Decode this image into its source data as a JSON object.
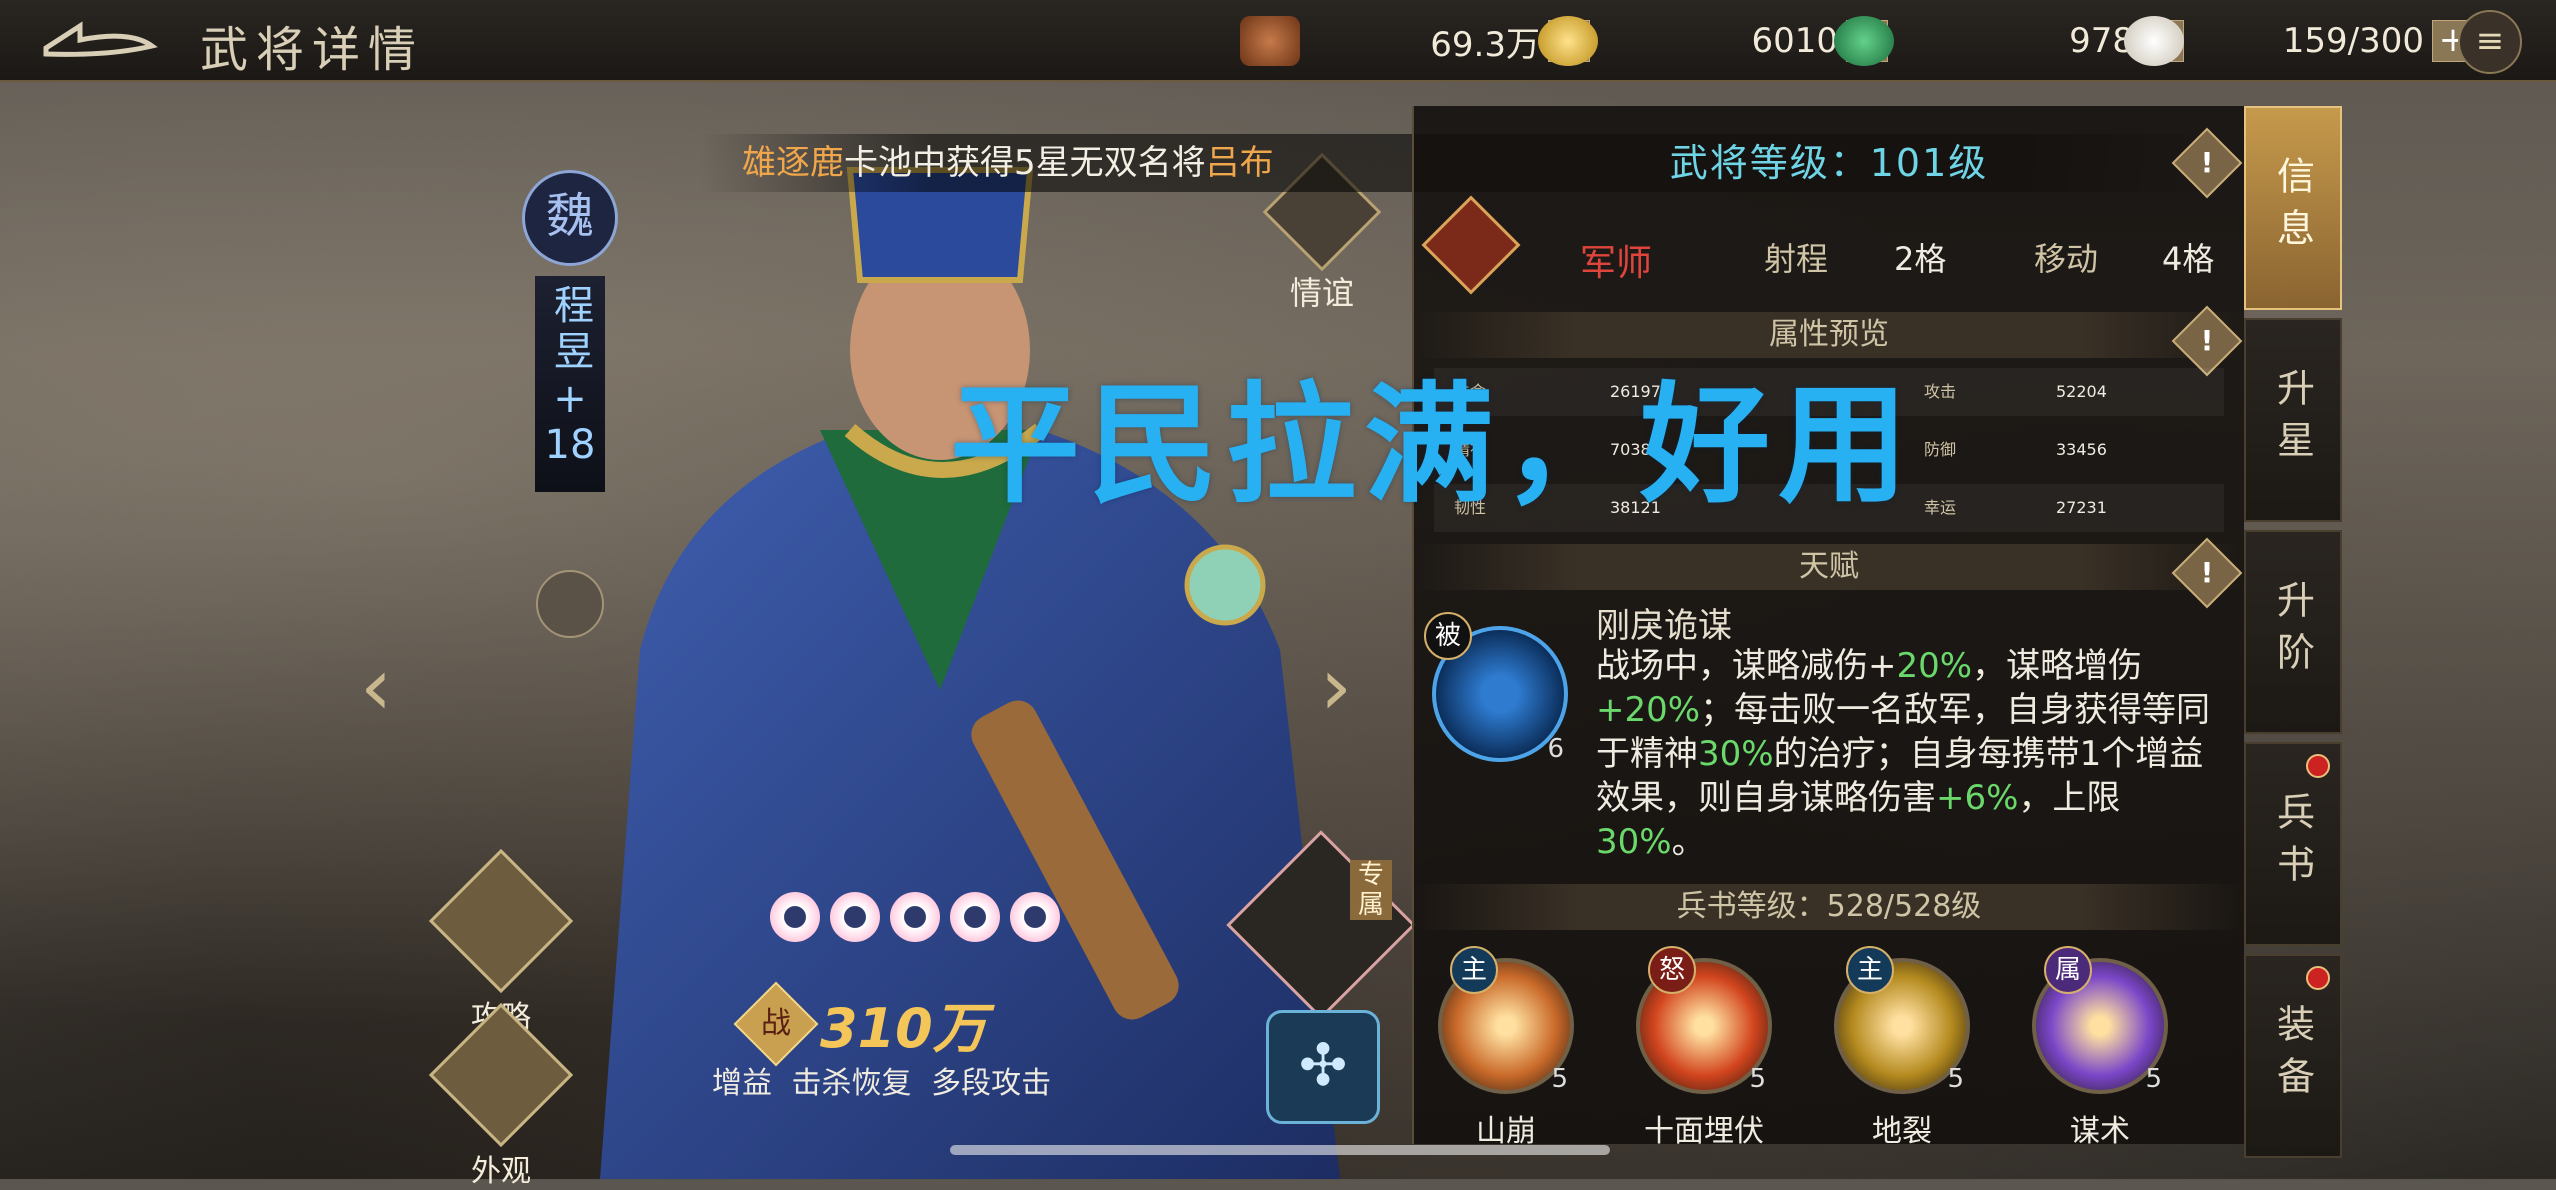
{
  "header": {
    "title": "武将详情",
    "resources": [
      {
        "icon": "copper-coins-icon",
        "value": "69.3万"
      },
      {
        "icon": "gold-coin-icon",
        "value": "6010"
      },
      {
        "icon": "jade-coin-icon",
        "value": "978"
      },
      {
        "icon": "steamed-bun-icon",
        "value": "159/300"
      }
    ],
    "plus_label": "+"
  },
  "announcement": {
    "player": "雄逐鹿",
    "middle": "卡池中获得5星无双名将",
    "hero": "吕布"
  },
  "hero": {
    "faction": "魏",
    "name": "程昱",
    "plus": "+",
    "rank": "18",
    "stars": 5,
    "power_badge": "战",
    "power": "310万",
    "traits": "增益 击杀恢复 多段攻击",
    "exclusive_tag": "专属"
  },
  "left_actions": {
    "strategy": "攻略",
    "appearance": "外观"
  },
  "bond": {
    "label": "情谊"
  },
  "overlay_caption": "平民拉满，好用",
  "panel": {
    "level_label": "武将等级：101级",
    "role": "军师",
    "range_label": "射程",
    "range_value": "2格",
    "move_label": "移动",
    "move_value": "4格",
    "attr_title": "属性预览",
    "attrs": [
      {
        "k": "生命",
        "v": "261973"
      },
      {
        "k": "攻击",
        "v": "52204"
      },
      {
        "k": "精神",
        "v": "70380"
      },
      {
        "k": "防御",
        "v": "33456"
      },
      {
        "k": "韧性",
        "v": "38121"
      },
      {
        "k": "幸运",
        "v": "27231"
      }
    ],
    "talent_title": "天赋",
    "talent": {
      "tag": "被",
      "level": "6",
      "name": "刚戾诡谋",
      "d1": "战场中，谋略减伤+",
      "g1": "20%",
      "d2": "，谋略增伤",
      "g2": "+20%",
      "d3": "；每击败一名敌军，自身获得等同于精神",
      "g3": "30%",
      "d4": "的治疗；自身每携带1个增益效果，则自身谋略伤害",
      "g4": "+6%",
      "d5": "，上限",
      "g5": "30%",
      "d6": "。"
    },
    "book_level": "兵书等级：528/528级",
    "skills": [
      {
        "tag": "主",
        "name": "山崩",
        "level": "5",
        "color": "#c96a2a"
      },
      {
        "tag": "怒",
        "name": "十面埋伏",
        "level": "5",
        "color": "#d2451e"
      },
      {
        "tag": "主",
        "name": "地裂",
        "level": "5",
        "color": "#b48a1f"
      },
      {
        "tag": "属",
        "name": "谋术",
        "level": "5",
        "color": "#7a46c8"
      }
    ]
  },
  "tabs": [
    {
      "label": "信息",
      "active": true
    },
    {
      "label": "升星"
    },
    {
      "label": "升阶"
    },
    {
      "label": "兵书",
      "dot": true
    },
    {
      "label": "装备",
      "dot": true
    }
  ],
  "nav": {
    "prev_arrow": "‹",
    "next_arrow": "›",
    "menu_icon": "≡"
  }
}
